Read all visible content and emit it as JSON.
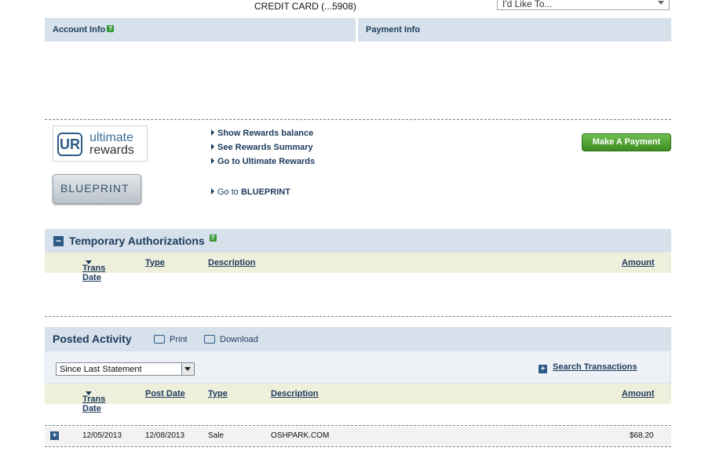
{
  "header": {
    "card_title": "CREDIT CARD (...5908)",
    "id_like_to": "I'd Like To..."
  },
  "tabs": {
    "account_info": "Account Info",
    "payment_info": "Payment Info",
    "help_glyph": "?"
  },
  "rewards": {
    "ur_mark": "UR",
    "ur_word1": "ultimate",
    "ur_word2": "rewards",
    "blueprint_text": "BLUEPRINT",
    "links": [
      "Show Rewards balance",
      "See Rewards Summary",
      "Go to Ultimate Rewards"
    ],
    "blueprint_link_prefix": "Go to",
    "blueprint_link_name": "BLUEPRINT",
    "make_payment": "Make A Payment"
  },
  "temp_auth": {
    "title": "Temporary Authorizations",
    "toggle_glyph": "−",
    "columns": {
      "trans_date": "Trans Date",
      "type": "Type",
      "description": "Description",
      "amount": "Amount"
    }
  },
  "posted": {
    "title": "Posted Activity",
    "print": "Print",
    "download": "Download",
    "filter_value": "Since Last Statement",
    "search": "Search Transactions",
    "columns": {
      "trans_date": "Trans Date",
      "post_date": "Post Date",
      "type": "Type",
      "description": "Description",
      "amount": "Amount"
    },
    "rows": [
      {
        "trans_date": "12/05/2013",
        "post_date": "12/08/2013",
        "type": "Sale",
        "description": "OSHPARK.COM",
        "amount": "$68.20"
      }
    ]
  }
}
